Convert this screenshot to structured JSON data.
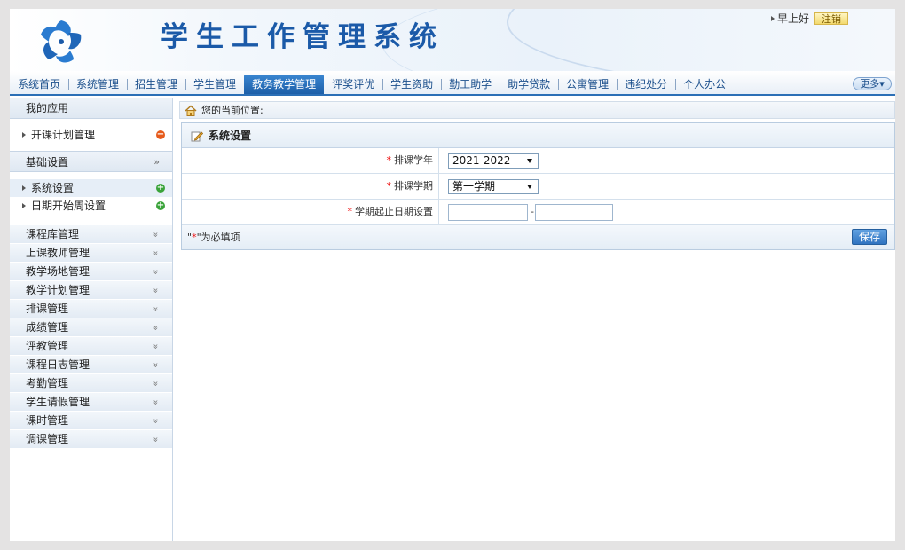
{
  "header": {
    "title": "学生工作管理系统",
    "greeting": "早上好",
    "logout_label": "注销"
  },
  "nav": {
    "items": [
      "系统首页",
      "系统管理",
      "招生管理",
      "学生管理",
      "教务教学管理",
      "评奖评优",
      "学生资助",
      "勤工助学",
      "助学贷款",
      "公寓管理",
      "违纪处分",
      "个人办公"
    ],
    "active": "教务教学管理",
    "more_label": "更多"
  },
  "sidebar": {
    "my_apps_label": "我的应用",
    "my_apps_items": [
      {
        "label": "开课计划管理",
        "action": "minus"
      }
    ],
    "basic_settings_label": "基础设置",
    "basic_settings_items": [
      {
        "label": "系统设置",
        "action": "plus"
      },
      {
        "label": "日期开始周设置",
        "action": "plus"
      }
    ],
    "categories": [
      "课程库管理",
      "上课教师管理",
      "教学场地管理",
      "教学计划管理",
      "排课管理",
      "成绩管理",
      "评教管理",
      "课程日志管理",
      "考勤管理",
      "学生请假管理",
      "课时管理",
      "调课管理"
    ]
  },
  "breadcrumb": {
    "label": "您的当前位置:"
  },
  "panel": {
    "title": "系统设置",
    "fields": {
      "year": {
        "label": "排课学年",
        "value": "2021-2022"
      },
      "term": {
        "label": "排课学期",
        "value": "第一学期"
      },
      "dates": {
        "label": "学期起止日期设置",
        "start": "",
        "end": "",
        "separator": "-"
      }
    },
    "required_note_prefix": "\"",
    "required_note_star": "*",
    "required_note_suffix": "\"为必填项",
    "save_label": "保存"
  },
  "colors": {
    "brand_blue": "#1b5aa8",
    "nav_active": "#2b6fb6",
    "required_red": "#e11111"
  }
}
